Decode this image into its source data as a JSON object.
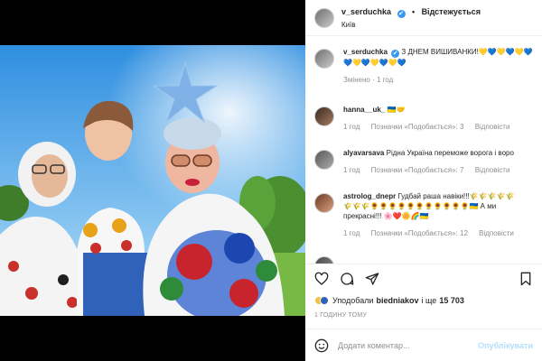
{
  "header": {
    "username": "v_serduchka",
    "verified_mark": "✔",
    "separator": "•",
    "follow_status": "Відстежується",
    "location": "Київ"
  },
  "caption": {
    "username": "v_serduchka",
    "text": "З ДНЕМ ВИШИВАНКИ!💛💙💛💙💛💙",
    "text_line2": "💙💛💙💛💙💛💙",
    "meta": "Змінено · 1 год"
  },
  "comments": [
    {
      "username": "hanna__uk_",
      "text": "🇺🇦🤝",
      "time": "1 год",
      "likes": "Позначки «Подобається»: 3",
      "reply": "Відповісти"
    },
    {
      "username": "alyavarsava",
      "text": "Рідна Україна переможе ворога і воро",
      "time": "1 год",
      "likes": "Позначки «Подобається»: 7",
      "reply": "Відповісти"
    },
    {
      "username": "astrolog_dnepr",
      "text": "Гудбай раша навіки!!!🌾🌾🌾🌾🌾",
      "text_line2": "🌾🌾🌾🌻🌻🌻🌻🌻🌻🌻🌻🌻🌻🌻🇺🇦 А ми",
      "text_line3": "прекрасні!!! 🌸❤️🌼🌈🇺🇦",
      "time": "1 год",
      "likes": "Позначки «Подобається»: 12",
      "reply": "Відповісти"
    }
  ],
  "actions": {
    "like_icon": "heart-icon",
    "comment_icon": "comment-icon",
    "share_icon": "send-icon",
    "save_icon": "bookmark-icon"
  },
  "likes": {
    "prefix": "Уподобали",
    "user": "biedniakov",
    "suffix": "і ще",
    "count": "15 703"
  },
  "timestamp": "1 ГОДИНУ ТОМУ",
  "add_comment": {
    "placeholder": "Додати коментар...",
    "emoji_icon": "smile-icon",
    "post_label": "Опублікувати"
  },
  "colors": {
    "accent": "#3897f0",
    "post_disabled": "#b2dffc",
    "muted": "#8e8e8e"
  }
}
